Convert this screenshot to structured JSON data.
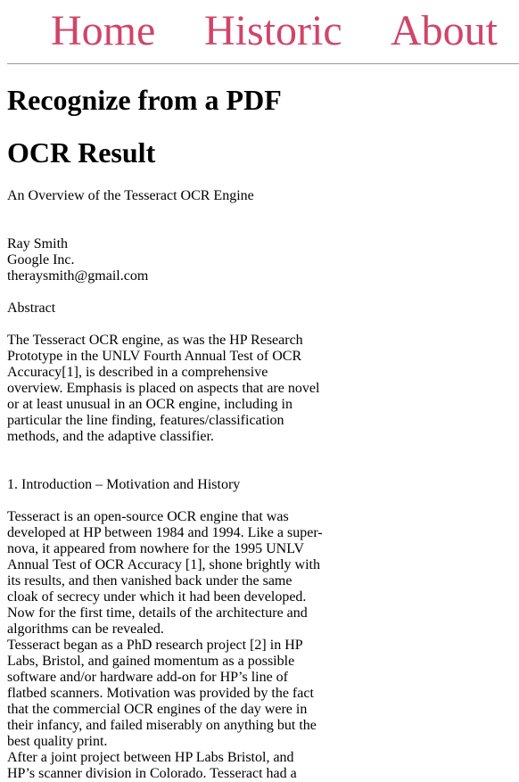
{
  "nav": {
    "items": [
      "Home",
      "Historic",
      "About"
    ],
    "accent_color": "#d0456a"
  },
  "page": {
    "heading": "Recognize from a PDF",
    "result_heading": "OCR Result"
  },
  "ocr": {
    "title": "An Overview of the Tesseract OCR Engine",
    "author_lines": [
      "Ray Smith",
      "Google Inc.",
      "theraysmith@gmail.com"
    ],
    "abstract_heading": "Abstract",
    "abstract_lines": [
      "The Tesseract OCR engine, as was the HP Research",
      "Prototype in the UNLV Fourth Annual Test of OCR",
      "Accuracy[1], is described in a comprehensive",
      "overview. Emphasis is placed on aspects that are novel",
      "or at least unusual in an OCR engine, including in",
      "particular the line finding, features/classification",
      "methods, and the adaptive classifier."
    ],
    "section_heading": "1. Introduction – Motivation and History",
    "body_lines": [
      "Tesseract is an open-source OCR engine that was",
      "developed at HP between 1984 and 1994. Like a super-",
      "nova, it appeared from nowhere for the 1995 UNLV",
      "Annual Test of OCR Accuracy [1], shone brightly with",
      "its results, and then vanished back under the same",
      "cloak of secrecy under which it had been developed.",
      "Now for the first time, details of the architecture and",
      "algorithms can be revealed.",
      "Tesseract began as a PhD research project [2] in HP",
      "Labs, Bristol, and gained momentum as a possible",
      "software and/or hardware add-on for HP’s line of",
      "flatbed scanners. Motivation was provided by the fact",
      "that the commercial OCR engines of the day were in",
      "their infancy, and failed miserably on anything but the",
      "best quality print.",
      "After a joint project between HP Labs Bristol, and",
      "HP’s scanner division in Colorado. Tesseract had a"
    ]
  }
}
